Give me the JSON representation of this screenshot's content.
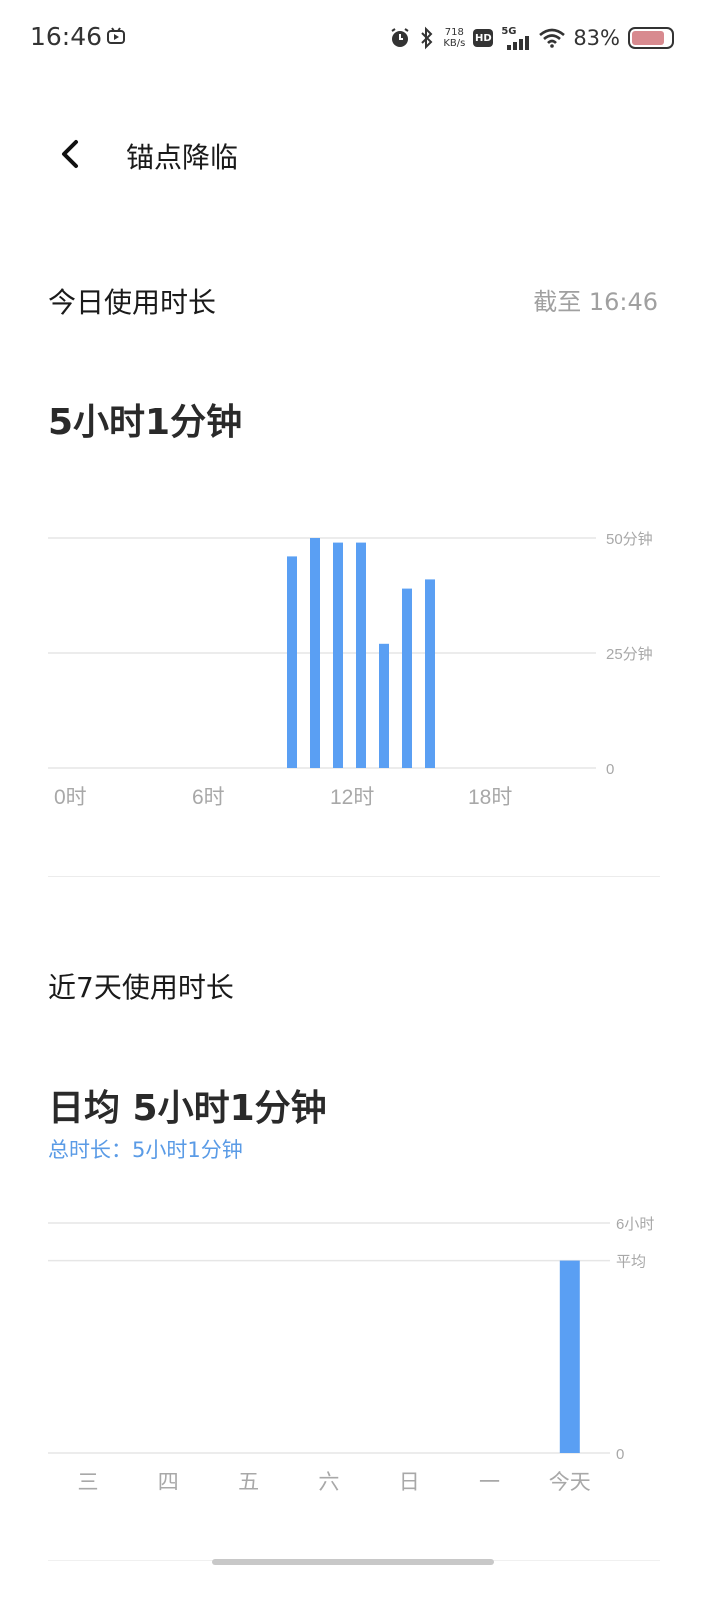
{
  "status_bar": {
    "time": "16:46",
    "speed_value": "718",
    "speed_unit": "KB/s",
    "hd_label": "HD",
    "network_label": "5G",
    "battery_percent_text": "83%",
    "battery_level": 0.83,
    "icons": [
      "app-icon",
      "alarm-icon",
      "bluetooth-icon",
      "signal-icon",
      "wifi-icon",
      "battery-icon"
    ]
  },
  "header": {
    "title": "锚点降临"
  },
  "today": {
    "title": "今日使用时长",
    "as_of": "截至 16:46",
    "total": "5小时1分钟"
  },
  "week": {
    "title": "近7天使用时长",
    "average": "日均 5小时1分钟",
    "total_line": "总时长：5小时1分钟"
  },
  "colors": {
    "bar": "#5a9ff3",
    "accent_text": "#5a9be6",
    "grid": "#e6e6e6",
    "label": "#a8a8a8"
  },
  "chart_data": [
    {
      "type": "bar",
      "x_ticks": [
        "0时",
        "6时",
        "12时",
        "18时"
      ],
      "x_tick_hours": [
        0,
        6,
        12,
        18
      ],
      "y_ticks": [
        "50分钟",
        "25分钟",
        "0"
      ],
      "y_tick_values": [
        50,
        25,
        0
      ],
      "ylim": [
        0,
        50
      ],
      "hours": [
        10,
        11,
        12,
        13,
        14,
        15,
        16
      ],
      "values": [
        46,
        50,
        49,
        49,
        27,
        39,
        41
      ],
      "grid": true
    },
    {
      "type": "bar",
      "categories": [
        "三",
        "四",
        "五",
        "六",
        "日",
        "一",
        "今天"
      ],
      "values": [
        0,
        0,
        0,
        0,
        0,
        0,
        5.02
      ],
      "y_ticks": [
        "6小时",
        "平均",
        "0"
      ],
      "y_tick_values": [
        6,
        5.02,
        0
      ],
      "ylim": [
        0,
        6
      ],
      "grid": true
    }
  ]
}
